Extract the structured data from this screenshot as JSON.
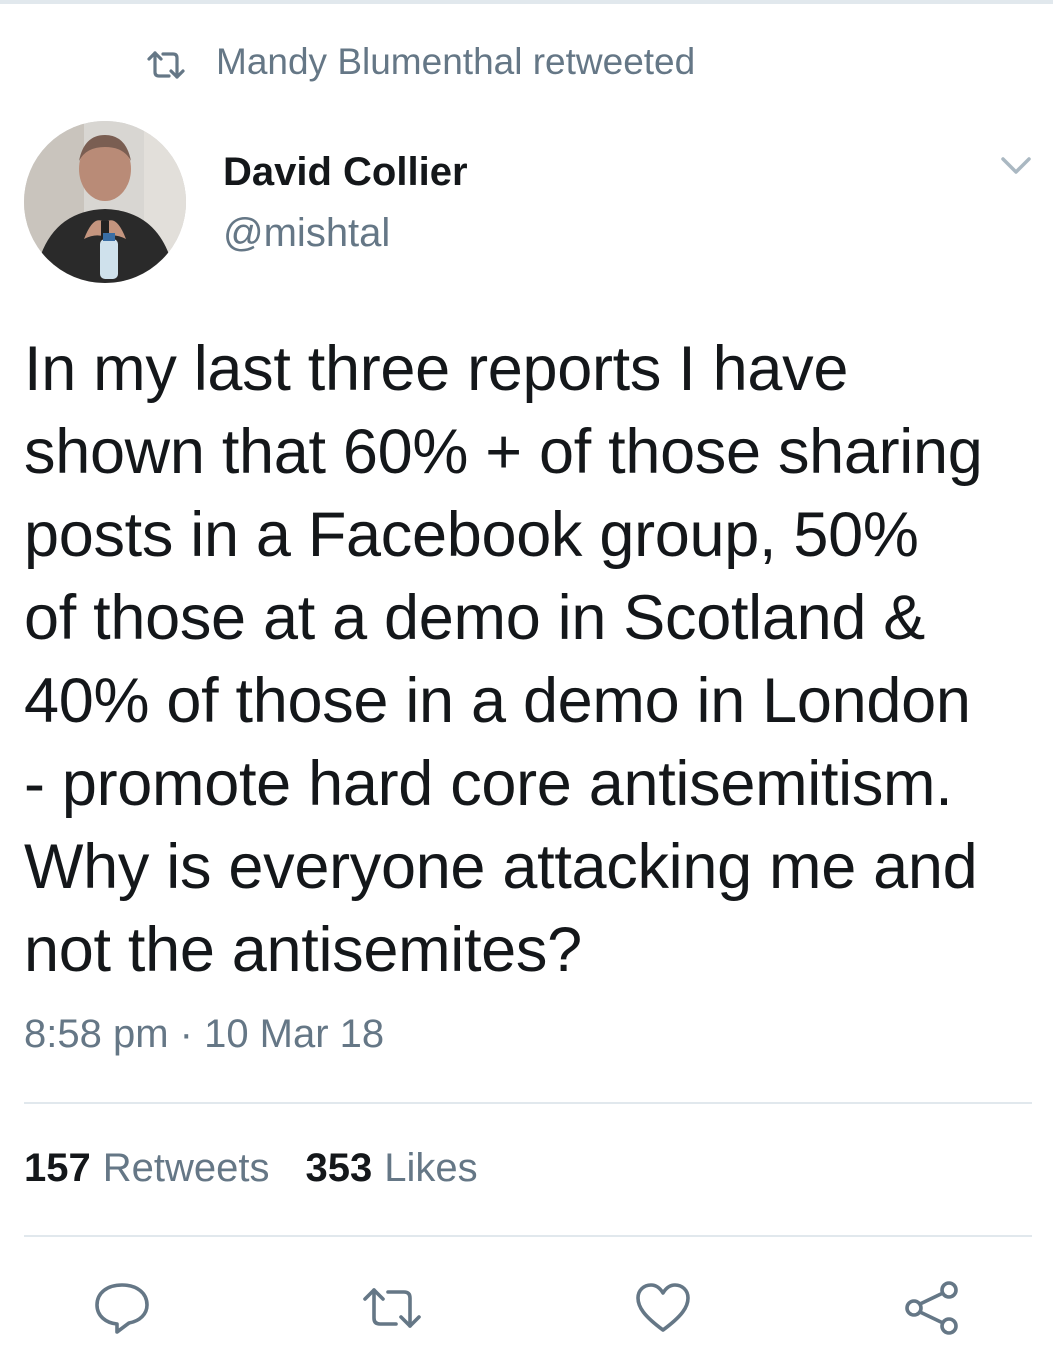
{
  "retweet_context": {
    "icon": "retweet-icon",
    "text": "Mandy Blumenthal retweeted"
  },
  "author": {
    "display_name": "David Collier",
    "handle": "@mishtal",
    "avatar": "avatar-photo"
  },
  "tweet": {
    "text": "In my last three reports I have\nshown that 60% + of those sharing\nposts in a Facebook group, 50%\nof those at a demo in Scotland &\n40% of those in a demo in London\n- promote hard core antisemitism.\nWhy is everyone attacking me and\nnot the antisemites?",
    "timestamp": "8:58 pm · 10 Mar 18"
  },
  "stats": {
    "retweets_count": "157",
    "retweets_label": "Retweets",
    "likes_count": "353",
    "likes_label": "Likes"
  },
  "actions": [
    {
      "name": "reply",
      "icon": "reply-icon"
    },
    {
      "name": "retweet",
      "icon": "retweet-icon"
    },
    {
      "name": "like",
      "icon": "heart-icon"
    },
    {
      "name": "share",
      "icon": "share-icon"
    }
  ],
  "colors": {
    "primary_text": "#14171a",
    "secondary_text": "#657786",
    "divider": "#e1e8ed",
    "background": "#ffffff"
  }
}
